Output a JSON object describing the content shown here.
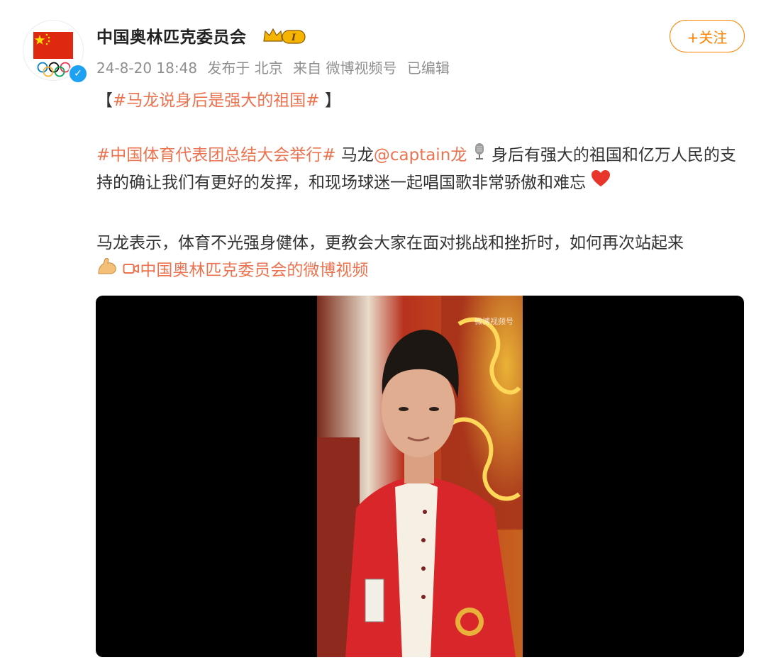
{
  "account": {
    "name": "中国奥林匹克委员会",
    "level_badge": "I",
    "verified_mark": "✓"
  },
  "post_meta": {
    "datetime": "24-8-20 18:48",
    "location": "发布于 北京",
    "source": "来自 微博视频号",
    "edited": "已编辑"
  },
  "follow_button": "+关注",
  "content": {
    "title_open": "【",
    "title_tag": "#马龙说身后是强大的祖国#",
    "title_close": " 】",
    "p1_tag": "#中国体育代表团总结大会举行#",
    "p1_text_a": " 马龙",
    "p1_mention": "@captain龙",
    "p1_text_b": " 身后有强大的祖国和亿万人民的支持的确让我们有更好的发挥，和现场球迷一起唱国歌非常骄傲和难忘",
    "p2_text": "马龙表示，体育不光强身健体，更教会大家在面对挑战和挫折时，如何再次站起来",
    "video_link": "中国奥林匹克委员会的微博视频"
  },
  "video": {
    "watermark": "微博视频号"
  },
  "icons": {
    "avatar_flag": "china-flag-icon",
    "avatar_rings": "olympic-rings-icon",
    "crown": "crown-badge-icon",
    "mic": "microphone-icon",
    "heart": "heart-icon",
    "muscle": "flexed-biceps-icon",
    "video": "video-camera-icon"
  },
  "colors": {
    "accent": "#ff8200",
    "link": "#eb7350",
    "meta": "#8f8f8f",
    "flag_red": "#de2910",
    "verified_blue": "#1da1f2"
  }
}
